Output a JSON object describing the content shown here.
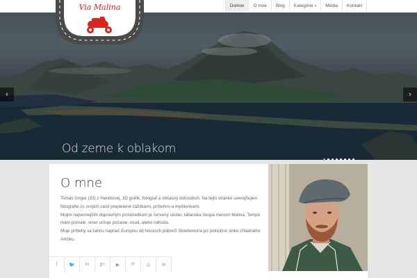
{
  "logo": {
    "text": "Via Malina"
  },
  "nav": {
    "items": [
      {
        "label": "Domov",
        "active": true
      },
      {
        "label": "O mne"
      },
      {
        "label": "Blog"
      },
      {
        "label": "Kategórie",
        "has_dropdown": true
      },
      {
        "label": "Média"
      },
      {
        "label": "Kontakt"
      }
    ]
  },
  "slider": {
    "caption": "Od zeme k oblakom",
    "prev_icon": "‹",
    "next_icon": "›",
    "dot_count": 8,
    "active_dot": 0
  },
  "about": {
    "title": "O mne",
    "paragraph1": "Tomáš Griger (33) z Handlovej, 3D grafik, fotograf a občasný dobrodruh. Na tejto stránke uverejňujem fotografie zo svojich ciest prepletené zážitkami, príbehmi a myšlienkami.",
    "paragraph2": "Mojim najvernejším dopravným prostriedkom je červený skúter, talianska Vespa menom Malina. Tempo mám pomalé, smer určuje počasie, osud, alebo náhoda.",
    "paragraph3": "Moje príbehy sa ťahnu naprieč Európou od horúcich pobreží Stredomoria po polnočné slnko chladného Arktíku."
  },
  "social": {
    "icons": [
      "facebook-icon",
      "twitter-icon",
      "linkedin-icon",
      "google-plus-icon",
      "youtube-icon",
      "pinterest-icon",
      "instagram-icon",
      "email-icon"
    ],
    "glyphs": [
      "f",
      "🐦",
      "in",
      "g+",
      "▶",
      "℗",
      "◎",
      "✉"
    ]
  }
}
